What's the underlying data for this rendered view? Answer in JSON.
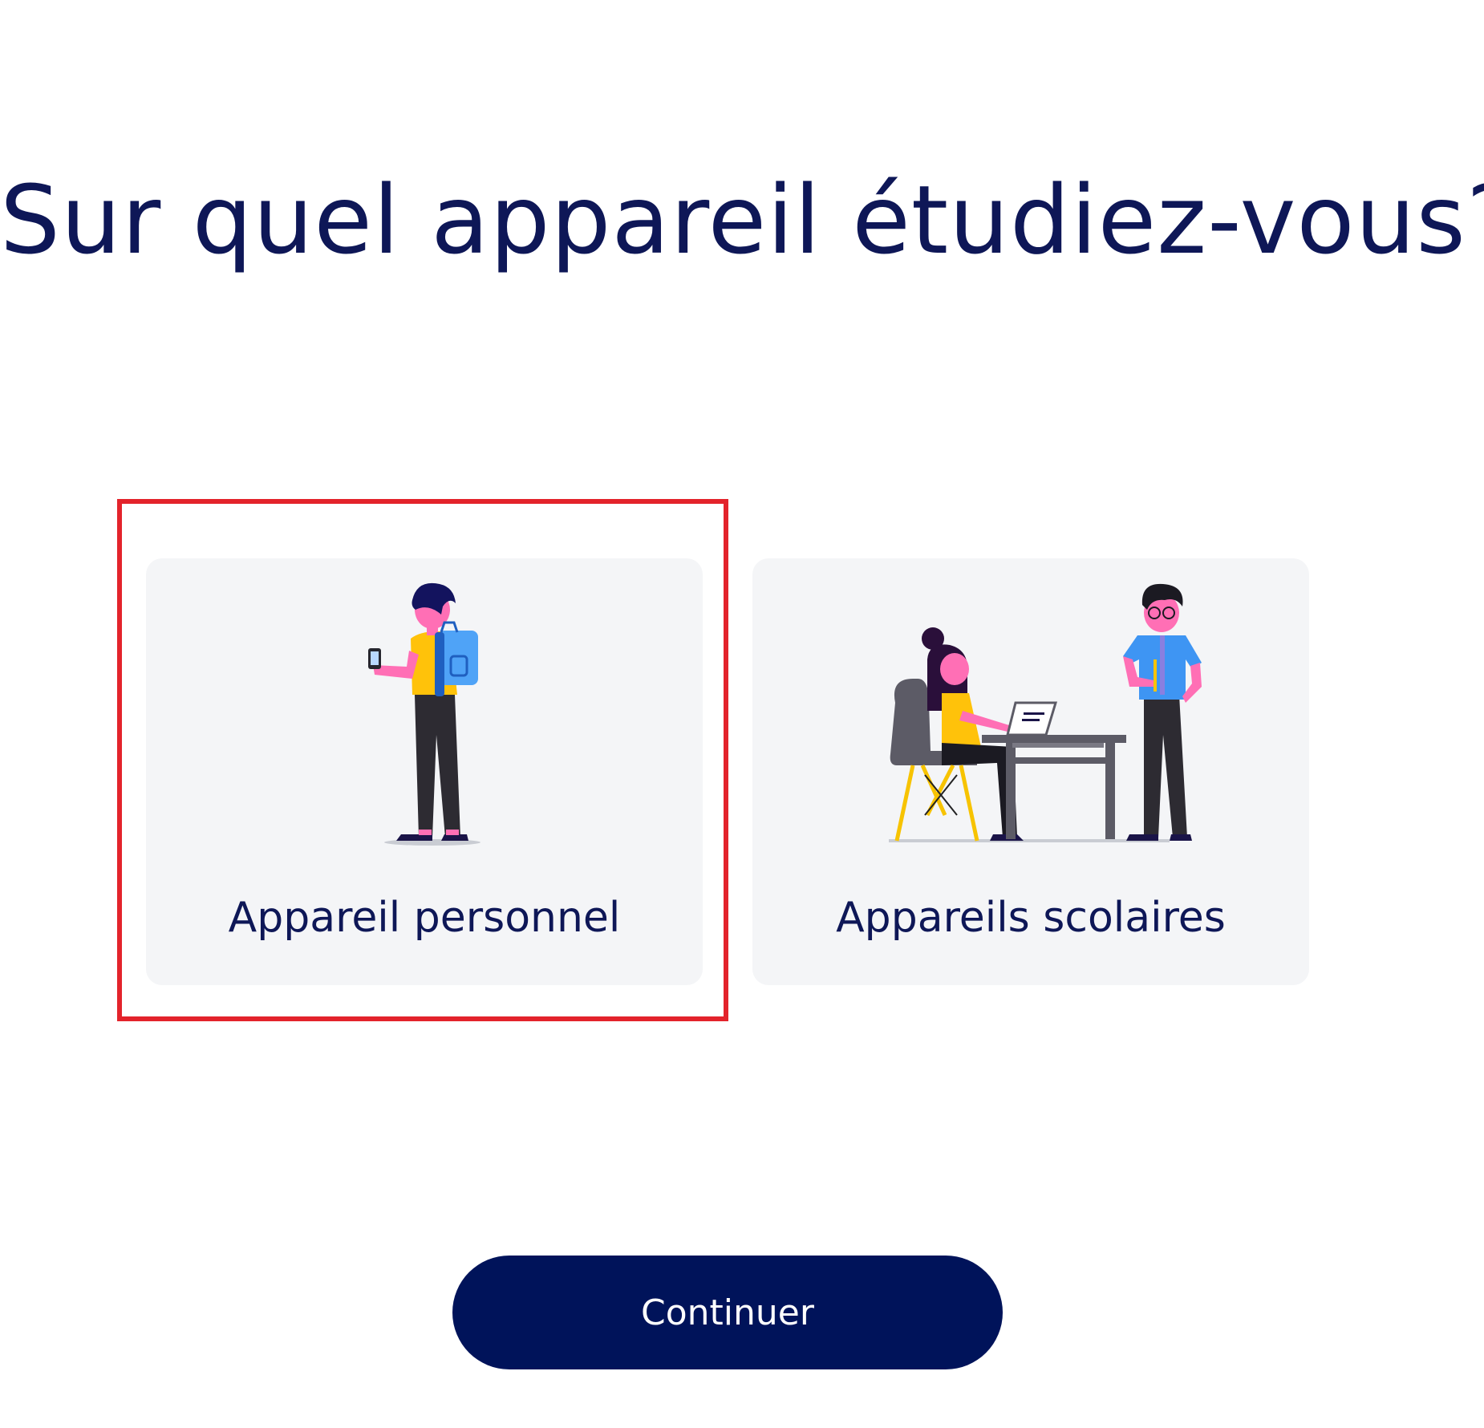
{
  "header": {
    "title": "Sur quel appareil étudiez-vous?"
  },
  "options": [
    {
      "label": "Appareil personnel",
      "illustration": "student-with-phone-and-backpack",
      "selected": true
    },
    {
      "label": "Appareils scolaires",
      "illustration": "student-at-desk-with-teacher",
      "selected": false
    }
  ],
  "footer": {
    "continue_label": "Continuer"
  },
  "colors": {
    "title_text": "#0e1757",
    "card_background": "#f4f5f7",
    "selection_outline": "#e3232b",
    "button_background": "#00135a",
    "button_text": "#ffffff"
  }
}
